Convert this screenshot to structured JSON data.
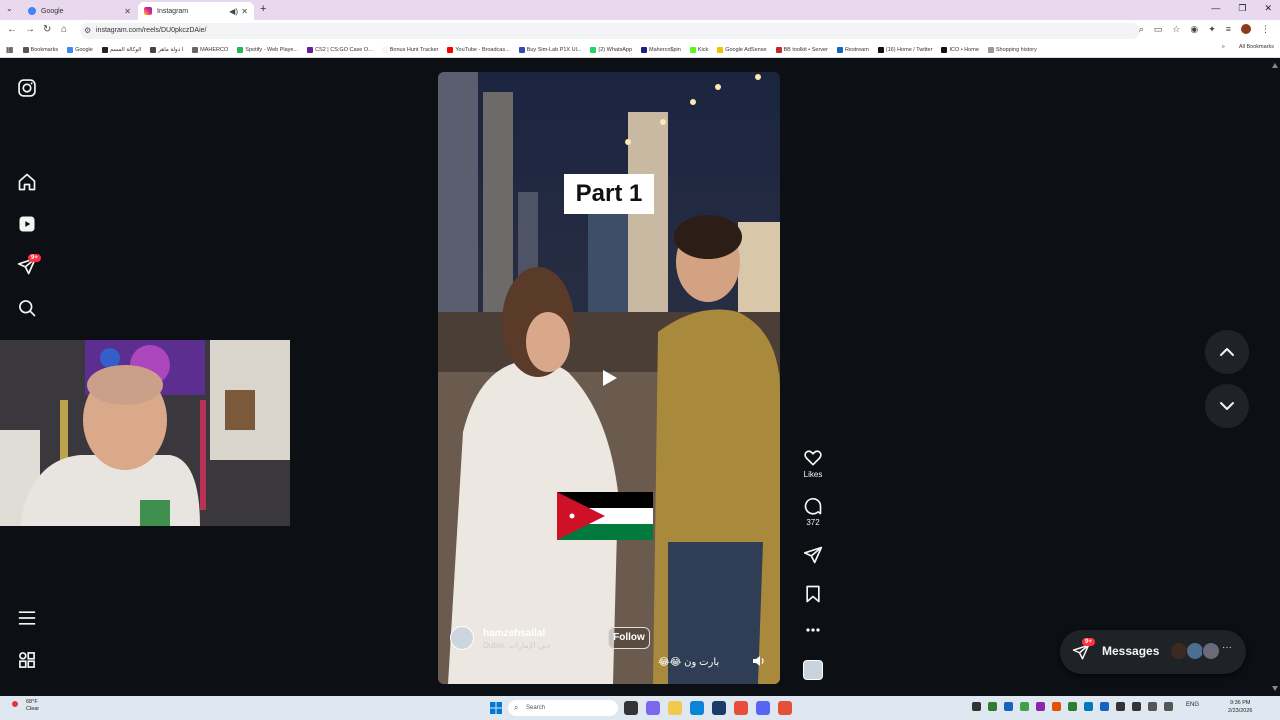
{
  "browser": {
    "tabs": [
      {
        "label": "Google",
        "active": false
      },
      {
        "label": "Instagram",
        "active": true
      }
    ],
    "new_tab": "+",
    "url": "instagram.com/reels/DU0pkczDAie/",
    "bookmarks": [
      {
        "label": "Bookmarks",
        "color": "#555555"
      },
      {
        "label": "Google",
        "color": "#4285f4"
      },
      {
        "label": "الوكالة المسم",
        "color": "#222222"
      },
      {
        "label": "ا دولة ماهر",
        "color": "#444444"
      },
      {
        "label": "MAHERCO",
        "color": "#666666"
      },
      {
        "label": "Spotify - Web Playe...",
        "color": "#1db954"
      },
      {
        "label": "CS2 | CS:GO Case O...",
        "color": "#6a1b9a"
      },
      {
        "label": "Bonus Hunt Tracker",
        "color": "#f5f5f5"
      },
      {
        "label": "YouTube - Broadcas...",
        "color": "#ff0000"
      },
      {
        "label": "Buy Sim-Lab P1X Ul...",
        "color": "#3949ab"
      },
      {
        "label": "(2) WhatsApp",
        "color": "#25d366"
      },
      {
        "label": "Maherco$pin",
        "color": "#1a237e"
      },
      {
        "label": "Kick",
        "color": "#53fc18"
      },
      {
        "label": "Google AdSense",
        "color": "#fbbc04"
      },
      {
        "label": "BB toolkit • Server",
        "color": "#c62828"
      },
      {
        "label": "Restream",
        "color": "#1565c0"
      },
      {
        "label": "(16) Home / Twitter",
        "color": "#111111"
      },
      {
        "label": "ICO • Home",
        "color": "#111111"
      },
      {
        "label": "Shopping history",
        "color": "#999999"
      }
    ],
    "all_bookmarks": "All Bookmarks"
  },
  "sidebar": {
    "icons": [
      "instagram-logo-icon",
      "home-icon",
      "reels-icon",
      "direct-icon",
      "search-icon",
      "menu-icon",
      "more-apps-icon"
    ],
    "direct_badge": "9+"
  },
  "reel": {
    "overlay_text": "Part 1",
    "owner_name": "hamzehsallal",
    "owner_location": "Dubai, دبي الإمارات",
    "follow_label": "Follow",
    "caption": "بارت ون 😂😂",
    "likes_label": "Likes",
    "comment_count": "372"
  },
  "messages": {
    "label": "Messages",
    "badge": "9+"
  },
  "taskbar": {
    "weather_temp": "68°F",
    "weather_desc": "Clear",
    "search_placeholder": "Search",
    "lang": "ENG",
    "time": "9:36 PM",
    "date": "2/23/2026"
  }
}
